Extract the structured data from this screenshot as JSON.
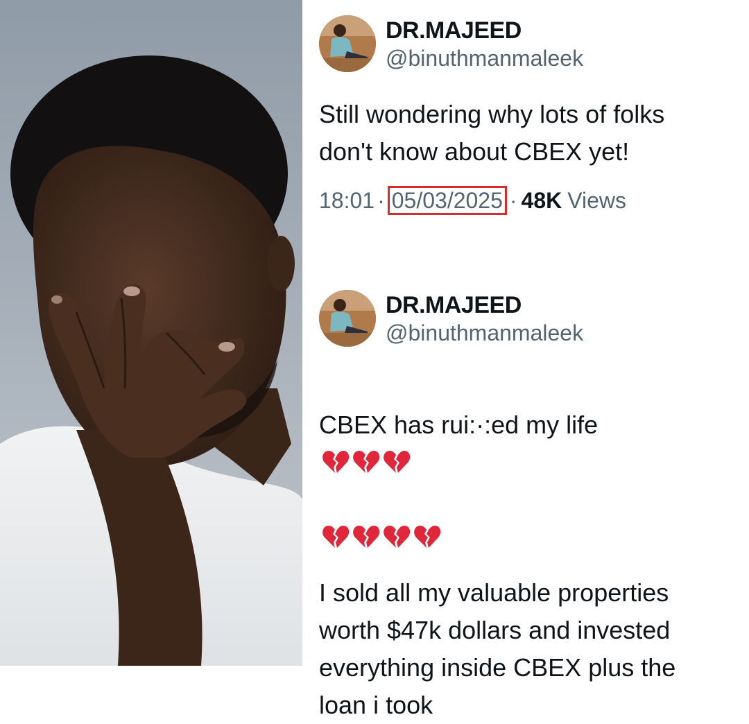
{
  "tweets": [
    {
      "display_name": "DR.MAJEED",
      "handle": "@binuthmanmaleek",
      "text": "Still wondering why lots of folks\ndon't know about CBEX yet!",
      "time": "18:01",
      "separator_1": "·",
      "date": "05/03/2025",
      "separator_2": "·",
      "views_count": "48K",
      "views_label": "Views"
    },
    {
      "display_name": "DR.MAJEED",
      "handle": "@binuthmanmaleek",
      "text_prefix": "CBEX has ru",
      "text_smudge": "i:·:",
      "text_suffix": "ed my life",
      "broken_heart_count": 7,
      "text_2": "I sold all my valuable properties\nworth $47k dollars and invested\neverything inside CBEX plus the\nloan i took"
    }
  ],
  "icons": {
    "broken_heart": "broken-heart-emoji",
    "avatar": "user-avatar-photo"
  },
  "colors": {
    "text_primary": "#0f1419",
    "text_secondary": "#536471",
    "highlight_box": "#d92b2b",
    "heart": "#e0263a"
  }
}
